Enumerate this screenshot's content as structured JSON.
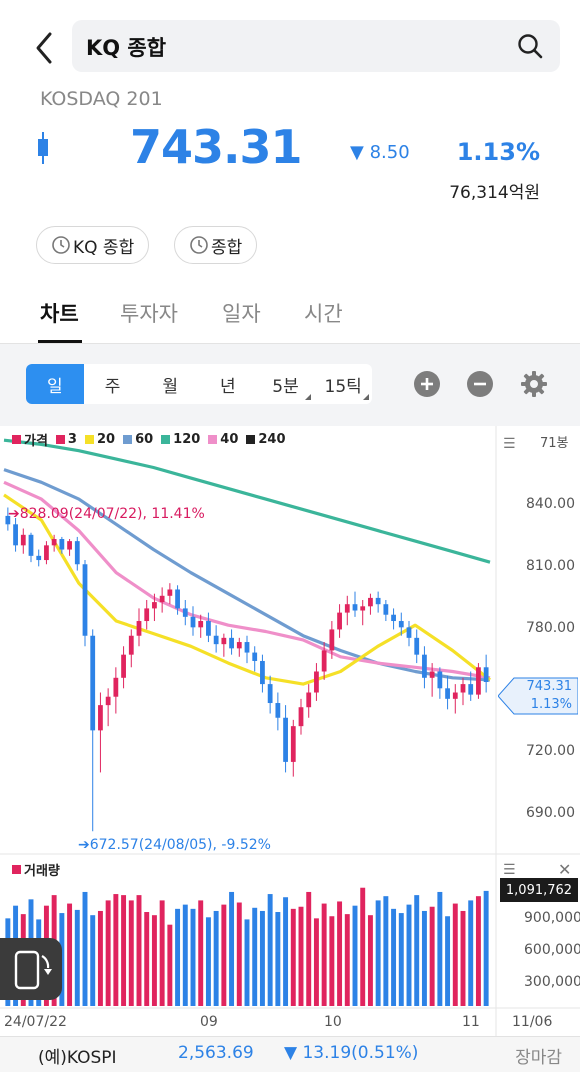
{
  "header": {
    "search_text": "KQ 종합",
    "market_name": "KOSDAQ 201",
    "price": "743.31",
    "change": "8.50",
    "change_direction": "down",
    "change_pct": "1.13%",
    "trade_value": "76,314억원"
  },
  "pills": [
    "KQ 종합",
    "종합"
  ],
  "tabs": [
    {
      "label": "차트",
      "active": true
    },
    {
      "label": "투자자",
      "active": false
    },
    {
      "label": "일자",
      "active": false
    },
    {
      "label": "시간",
      "active": false
    }
  ],
  "periods": [
    {
      "label": "일",
      "active": true,
      "dropdown": false
    },
    {
      "label": "주",
      "active": false,
      "dropdown": false
    },
    {
      "label": "월",
      "active": false,
      "dropdown": false
    },
    {
      "label": "년",
      "active": false,
      "dropdown": false
    },
    {
      "label": "5분",
      "active": false,
      "dropdown": true
    },
    {
      "label": "15틱",
      "active": false,
      "dropdown": true
    }
  ],
  "chart": {
    "legend": [
      {
        "label": "가격",
        "color": "#e0245e"
      },
      {
        "label": "3",
        "color": "#e0245e"
      },
      {
        "label": "20",
        "color": "#f5e027"
      },
      {
        "label": "60",
        "color": "#6f9cd0"
      },
      {
        "label": "120",
        "color": "#3bb59a"
      },
      {
        "label": "40",
        "color": "#ef8fc9"
      },
      {
        "label": "240",
        "color": "#222222"
      }
    ],
    "unit": "71봉",
    "current_price_flag": "743.31",
    "current_pct_flag": "1.13%",
    "annotation_high": "➔828.09(24/07/22), 11.41%",
    "annotation_low": "➔672.57(24/08/05), -9.52%",
    "volume_label": "거래량",
    "volume_flag": "1,091,762"
  },
  "chart_data": {
    "type": "candlestick",
    "y_ticks": [
      "840.00",
      "810.00",
      "780.00",
      "750.00",
      "720.00",
      "690.00"
    ],
    "ylim": [
      665,
      860
    ],
    "x_ticks": [
      "24/07/22",
      "09",
      "10",
      "11",
      "11/06"
    ],
    "volume_ticks": [
      "900,000",
      "600,000",
      "300,000"
    ],
    "high_point": {
      "value": 828.09,
      "date": "24/07/22",
      "pct": "11.41%"
    },
    "low_point": {
      "value": 672.57,
      "date": "24/08/05",
      "pct": "-9.52%"
    },
    "candles": [
      [
        822,
        826,
        815,
        818
      ],
      [
        818,
        821,
        805,
        808
      ],
      [
        808,
        816,
        804,
        813
      ],
      [
        813,
        814,
        800,
        803
      ],
      [
        803,
        806,
        798,
        801
      ],
      [
        801,
        810,
        799,
        808
      ],
      [
        808,
        813,
        805,
        811
      ],
      [
        811,
        812,
        804,
        806
      ],
      [
        806,
        811,
        803,
        810
      ],
      [
        810,
        812,
        796,
        799
      ],
      [
        799,
        801,
        760,
        765
      ],
      [
        765,
        768,
        672,
        720
      ],
      [
        720,
        738,
        700,
        732
      ],
      [
        732,
        740,
        722,
        736
      ],
      [
        736,
        750,
        728,
        745
      ],
      [
        745,
        760,
        740,
        756
      ],
      [
        756,
        768,
        750,
        765
      ],
      [
        765,
        778,
        760,
        772
      ],
      [
        772,
        782,
        768,
        778
      ],
      [
        778,
        785,
        772,
        781
      ],
      [
        781,
        788,
        776,
        784
      ],
      [
        784,
        790,
        780,
        787
      ],
      [
        787,
        789,
        775,
        778
      ],
      [
        778,
        782,
        770,
        774
      ],
      [
        774,
        779,
        765,
        769
      ],
      [
        769,
        775,
        764,
        772
      ],
      [
        772,
        776,
        762,
        765
      ],
      [
        765,
        770,
        757,
        761
      ],
      [
        761,
        766,
        755,
        764
      ],
      [
        764,
        768,
        756,
        759
      ],
      [
        759,
        764,
        755,
        762
      ],
      [
        762,
        765,
        752,
        757
      ],
      [
        757,
        760,
        748,
        753
      ],
      [
        753,
        756,
        738,
        742
      ],
      [
        742,
        746,
        728,
        733
      ],
      [
        733,
        738,
        720,
        726
      ],
      [
        726,
        732,
        700,
        705
      ],
      [
        705,
        725,
        698,
        722
      ],
      [
        722,
        735,
        718,
        731
      ],
      [
        731,
        742,
        726,
        738
      ],
      [
        738,
        752,
        734,
        748
      ],
      [
        748,
        762,
        744,
        758
      ],
      [
        758,
        772,
        754,
        768
      ],
      [
        768,
        780,
        764,
        776
      ],
      [
        776,
        784,
        770,
        780
      ],
      [
        780,
        786,
        774,
        777
      ],
      [
        777,
        782,
        770,
        779
      ],
      [
        779,
        785,
        775,
        783
      ],
      [
        783,
        786,
        776,
        780
      ],
      [
        780,
        782,
        772,
        775
      ],
      [
        775,
        778,
        768,
        772
      ],
      [
        772,
        776,
        765,
        769
      ],
      [
        769,
        772,
        760,
        764
      ],
      [
        764,
        768,
        752,
        756
      ],
      [
        756,
        760,
        740,
        745
      ],
      [
        745,
        752,
        736,
        748
      ],
      [
        748,
        750,
        735,
        740
      ],
      [
        740,
        746,
        730,
        735
      ],
      [
        735,
        742,
        728,
        738
      ],
      [
        738,
        745,
        732,
        742
      ],
      [
        742,
        748,
        734,
        737
      ],
      [
        737,
        752,
        735,
        750
      ],
      [
        750,
        756,
        738,
        743
      ]
    ],
    "ma_series": [
      {
        "name": "120",
        "color": "#3bb59a",
        "values": [
          858,
          856,
          853,
          849,
          845,
          840,
          835,
          830,
          825,
          820,
          815,
          810,
          805,
          800
        ]
      },
      {
        "name": "60",
        "color": "#6f9cd0",
        "values": [
          844,
          838,
          830,
          818,
          806,
          795,
          785,
          775,
          765,
          758,
          752,
          748,
          745,
          744
        ]
      },
      {
        "name": "40",
        "color": "#ef8fc9",
        "values": [
          838,
          830,
          815,
          795,
          783,
          775,
          770,
          767,
          763,
          755,
          752,
          750,
          748,
          745
        ]
      },
      {
        "name": "20",
        "color": "#f5e027",
        "values": [
          832,
          820,
          790,
          772,
          766,
          760,
          752,
          745,
          742,
          748,
          760,
          770,
          758,
          744
        ]
      }
    ],
    "volume": [
      830,
      950,
      870,
      1010,
      820,
      950,
      1050,
      880,
      970,
      910,
      1080,
      860,
      900,
      1000,
      1060,
      1050,
      1000,
      1050,
      890,
      860,
      1000,
      770,
      920,
      960,
      920,
      1000,
      840,
      900,
      960,
      1080,
      980,
      820,
      930,
      900,
      1060,
      890,
      1030,
      920,
      940,
      1080,
      830,
      970,
      850,
      990,
      870,
      950,
      1120,
      860,
      1000,
      1040,
      920,
      880,
      960,
      1050,
      900,
      940,
      1080,
      850,
      970,
      900,
      1000,
      1040,
      1090
    ]
  },
  "footer": {
    "name": "(예)KOSPI",
    "value": "2,563.69",
    "change": "▼ 13.19",
    "change_pct": "(0.51%)",
    "status": "장마감"
  }
}
